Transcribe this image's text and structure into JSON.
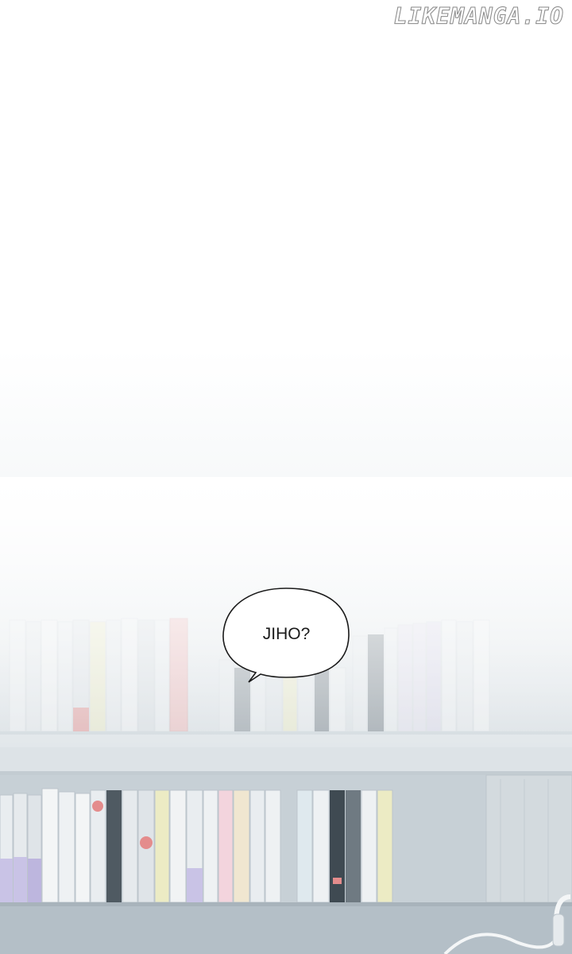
{
  "watermark": "LIKEMANGA.IO",
  "speech_bubble": {
    "text": "JIHO?"
  },
  "colors": {
    "shelf": "#c9d2d8",
    "shelf_edge": "#b4bec6",
    "book_light": "#e9edf0",
    "book_dark": "#6f7a82",
    "accent_red": "#e48c8c",
    "accent_yellow": "#ecebc4",
    "accent_purple": "#c9c3e6"
  },
  "icons": [
    "speech-bubble-tail",
    "bookshelf",
    "headphones-cable"
  ]
}
